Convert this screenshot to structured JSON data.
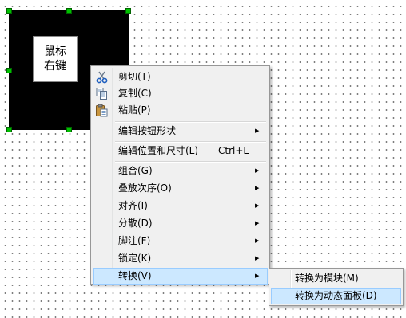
{
  "shape": {
    "label": "鼠标\n右键"
  },
  "context_menu": {
    "items": [
      {
        "name": "cut",
        "label": "剪切(T)",
        "icon": "scissors-icon"
      },
      {
        "name": "copy",
        "label": "复制(C)",
        "icon": "copy-icon"
      },
      {
        "name": "paste",
        "label": "粘贴(P)",
        "icon": "paste-icon"
      },
      {
        "name": "edit-button-shape",
        "label": "编辑按钮形状",
        "submenu": true
      },
      {
        "name": "edit-position-size",
        "label": "编辑位置和尺寸(L)",
        "shortcut": "Ctrl+L"
      },
      {
        "name": "group",
        "label": "组合(G)",
        "submenu": true
      },
      {
        "name": "stack-order",
        "label": "叠放次序(O)",
        "submenu": true
      },
      {
        "name": "align",
        "label": "对齐(I)",
        "submenu": true
      },
      {
        "name": "distribute",
        "label": "分散(D)",
        "submenu": true
      },
      {
        "name": "footnote",
        "label": "脚注(F)",
        "submenu": true
      },
      {
        "name": "lock",
        "label": "锁定(K)",
        "submenu": true
      },
      {
        "name": "convert",
        "label": "转换(V)",
        "submenu": true,
        "highlighted": true
      }
    ]
  },
  "convert_submenu": {
    "items": [
      {
        "name": "convert-to-module",
        "label": "转换为模块(M)"
      },
      {
        "name": "convert-to-dynamic-panel",
        "label": "转换为动态面板(D)",
        "highlighted": true
      }
    ]
  },
  "colors": {
    "menu_background": "#f0f0f0",
    "highlight": "#cce8ff",
    "highlight_border": "#99ccff",
    "selection_handle": "#00c000"
  }
}
